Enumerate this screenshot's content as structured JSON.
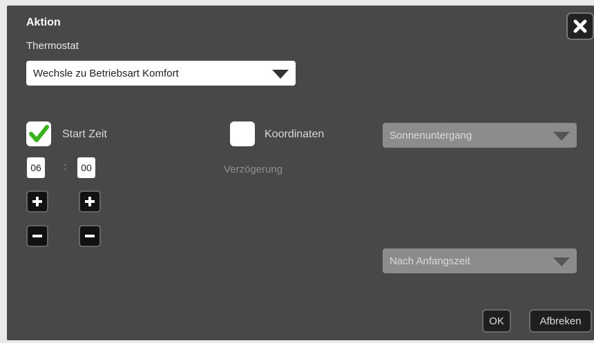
{
  "dialog": {
    "title": "Aktion",
    "subtitle": "Thermostat",
    "close_icon": "close-icon"
  },
  "action_select": {
    "value": "Wechsle zu Betriebsart Komfort"
  },
  "start_time": {
    "label": "Start Zeit",
    "checked": true,
    "hour": "06",
    "separator": ":",
    "minute": "00"
  },
  "coordinates": {
    "label": "Koordinaten",
    "checked": false,
    "delay_label": "Verzögerung"
  },
  "sun_select": {
    "value": "Sonnenuntergang",
    "disabled": true
  },
  "after_select": {
    "value": "Nach Anfangszeit",
    "disabled": true
  },
  "buttons": {
    "ok": "OK",
    "cancel": "Afbreken"
  },
  "colors": {
    "dialog_bg": "#484848",
    "check": "#3ab21f",
    "disabled_select": "#8c8c8c"
  }
}
